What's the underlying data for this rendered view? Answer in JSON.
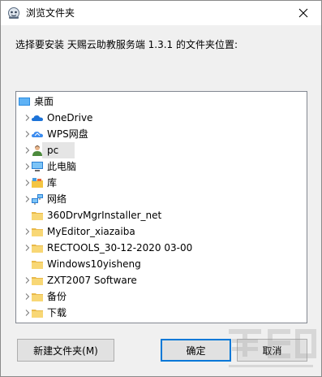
{
  "window": {
    "title": "浏览文件夹",
    "close_glyph": "✕"
  },
  "instruction": "选择要安装 天赐云助教服务端 1.3.1 的文件夹位置:",
  "tree": {
    "items": [
      {
        "label": "桌面",
        "icon": "desktop-icon",
        "expandable": false,
        "level": 0
      },
      {
        "label": "OneDrive",
        "icon": "onedrive-cloud-icon",
        "expandable": true,
        "level": 1
      },
      {
        "label": "WPS网盘",
        "icon": "wps-cloud-icon",
        "expandable": true,
        "level": 1
      },
      {
        "label": "pc",
        "icon": "user-icon",
        "expandable": true,
        "level": 1,
        "selected": true
      },
      {
        "label": "此电脑",
        "icon": "computer-icon",
        "expandable": true,
        "level": 1
      },
      {
        "label": "库",
        "icon": "library-icon",
        "expandable": true,
        "level": 1
      },
      {
        "label": "网络",
        "icon": "network-icon",
        "expandable": true,
        "level": 1
      },
      {
        "label": "360DrvMgrInstaller_net",
        "icon": "folder-icon",
        "expandable": false,
        "level": 1
      },
      {
        "label": "MyEditor_xiazaiba",
        "icon": "folder-icon",
        "expandable": true,
        "level": 1
      },
      {
        "label": "RECTOOLS_30-12-2020 03-00",
        "icon": "folder-icon",
        "expandable": true,
        "level": 1
      },
      {
        "label": "Windows10yisheng",
        "icon": "folder-icon",
        "expandable": false,
        "level": 1
      },
      {
        "label": "ZXT2007 Software",
        "icon": "folder-icon",
        "expandable": true,
        "level": 1
      },
      {
        "label": "备份",
        "icon": "folder-icon",
        "expandable": true,
        "level": 1
      },
      {
        "label": "下载",
        "icon": "folder-icon",
        "expandable": true,
        "level": 1
      }
    ]
  },
  "buttons": {
    "new_folder": "新建文件夹(M)",
    "ok": "确定",
    "cancel": "取消"
  },
  "colors": {
    "folder": "#f8d775",
    "accent": "#0078d7",
    "selection": "#e5e5e5"
  }
}
